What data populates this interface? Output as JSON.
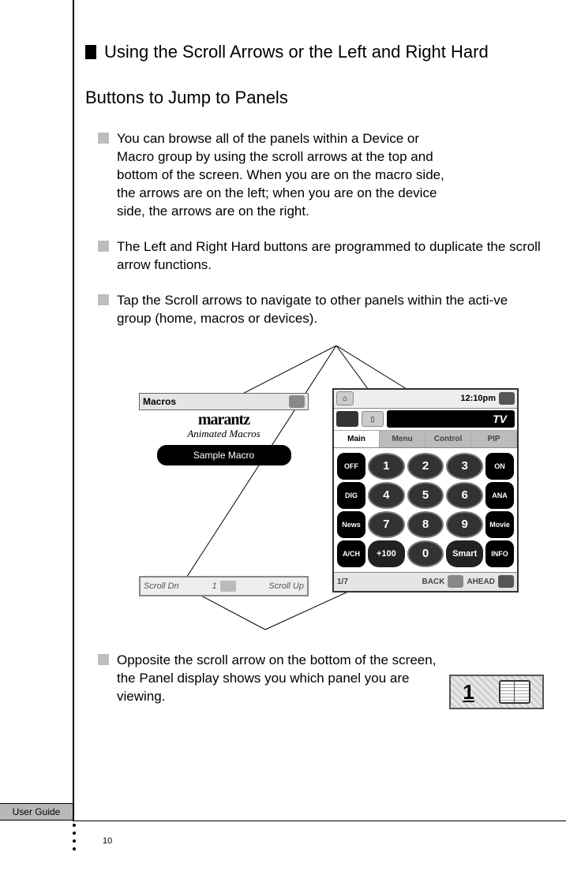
{
  "heading_line1": "Using the Scroll Arrows or the Left and Right Hard",
  "heading_line2": "Buttons to Jump to Panels",
  "bullets": {
    "b1": "You can browse all of the panels within a Device or Macro group by using the scroll arrows at the top and bottom of the screen. When you are on the macro side, the arrows are on the left; when you are on the device side, the arrows are on the right.",
    "b2": "The Left and Right Hard buttons are programmed to duplicate the scroll arrow functions.",
    "b3": "Tap the Scroll arrows to navigate to other panels within the acti-ve group (home, macros or devices).",
    "b4": "Opposite the scroll arrow on the bottom of the screen, the Panel display shows you which panel you are viewing."
  },
  "left_shot": {
    "top_label": "Macros",
    "brand": "marantz",
    "subtitle": "Animated Macros",
    "pill": "Sample Macro",
    "bottom_left": "Scroll Dn",
    "bottom_mid": "1",
    "bottom_right": "Scroll Up"
  },
  "right_shot": {
    "time": "12:10pm",
    "device_label": "TV",
    "tabs": {
      "t1": "Main",
      "t2": "Menu",
      "t3": "Control",
      "t4": "PIP"
    },
    "side_left": {
      "r1": "OFF",
      "r2": "DIG",
      "r3": "News",
      "r4": "A/CH"
    },
    "side_right": {
      "r1": "ON",
      "r2": "ANA",
      "r3": "Movie",
      "r4": "INFO"
    },
    "nums": {
      "n1": "1",
      "n2": "2",
      "n3": "3",
      "n4": "4",
      "n5": "5",
      "n6": "6",
      "n7": "7",
      "n8": "8",
      "n9": "9",
      "n0": "0"
    },
    "plus100": "+100",
    "smart": "Smart",
    "bottom": {
      "page": "1/7",
      "back": "BACK",
      "ahead": "AHEAD"
    }
  },
  "panel_indicator": {
    "num": "1"
  },
  "footer_tab": "User Guide",
  "page_number": "10"
}
